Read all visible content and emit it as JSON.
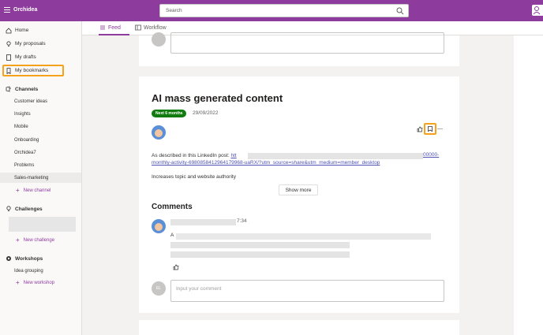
{
  "app": {
    "title": "Orchidea"
  },
  "search": {
    "placeholder": "Search"
  },
  "sidebar": {
    "nav": [
      {
        "label": "Home",
        "icon": "home-icon"
      },
      {
        "label": "My proposals",
        "icon": "lightbulb-icon"
      },
      {
        "label": "My drafts",
        "icon": "document-icon"
      },
      {
        "label": "My bookmarks",
        "icon": "bookmark-icon"
      }
    ],
    "channels": {
      "title": "Channels",
      "items": [
        "Customer ideas",
        "Insights",
        "Mobile",
        "Onboarding",
        "Orchidea7",
        "Problems",
        "Sales-marketing"
      ],
      "active": "Sales-marketing",
      "add_label": "New channel"
    },
    "challenges": {
      "title": "Challenges",
      "add_label": "New challenge"
    },
    "workshops": {
      "title": "Workshops",
      "items": [
        "Idea grouping"
      ],
      "add_label": "New workshop"
    }
  },
  "tabs": [
    {
      "label": "Feed",
      "active": true
    },
    {
      "label": "Workflow",
      "active": false
    }
  ],
  "post": {
    "title": "AI mass generated content",
    "badge": "Next 6 months",
    "badge_color": "#107c10",
    "date": "29/09/2022",
    "description_prefix": "As described in this LinkedIn post: ",
    "link_start": "htt",
    "link_end": "00000-",
    "link_line2": "monthly-activity-6980858412964179968-uaRX/?utm_source=share&utm_medium=member_desktop",
    "description_line2": "Increases topic and website authority",
    "show_more": "Show more"
  },
  "comments": {
    "title": "Comments",
    "first": {
      "time": "7:34",
      "text_start": "A"
    },
    "composer": {
      "avatar_initials": "EL",
      "placeholder": "Input your comment"
    }
  },
  "colors": {
    "brand": "#8e3b9e",
    "highlight": "#f5a21a",
    "link": "#4f52b2"
  }
}
